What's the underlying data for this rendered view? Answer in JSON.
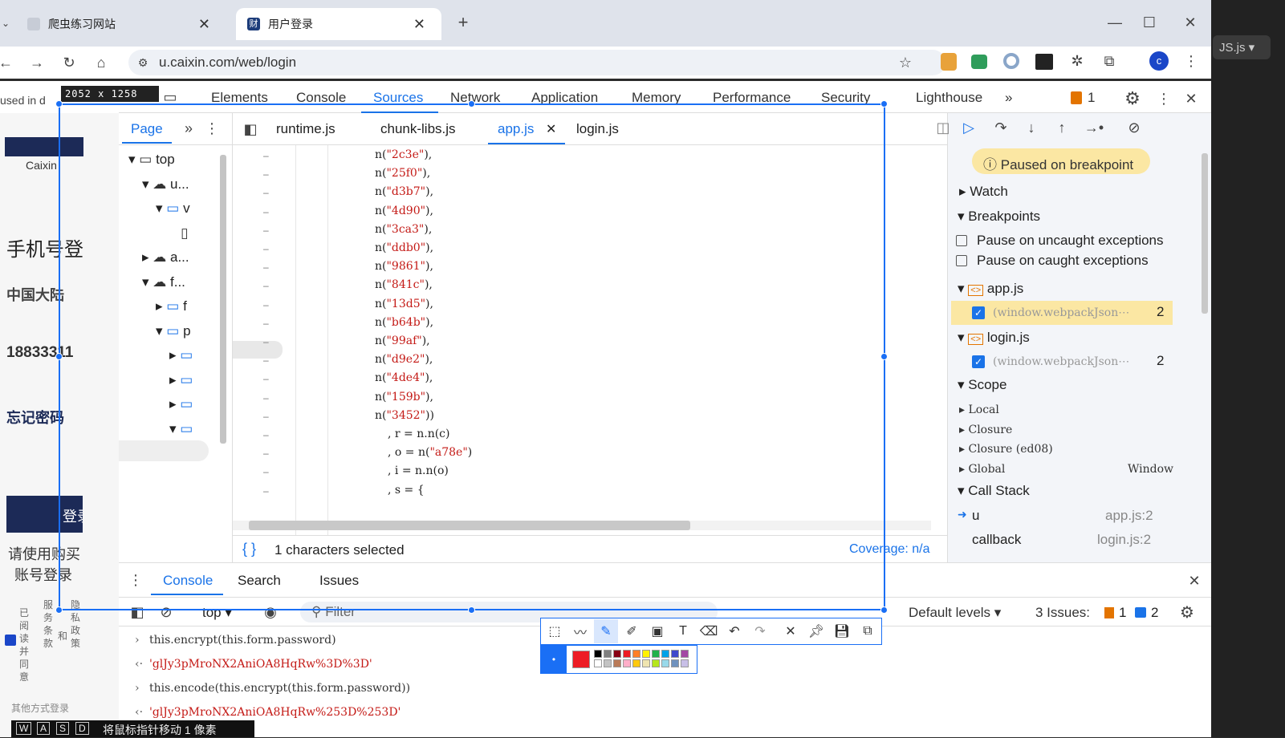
{
  "browser": {
    "tabs": [
      {
        "label": "爬虫练习网站",
        "active": false
      },
      {
        "label": "用户登录",
        "active": true
      }
    ],
    "new_tab": "+",
    "url": "u.caixin.com/web/login",
    "profile_initial": "c"
  },
  "right_edge": {
    "file_chip": "JS.js"
  },
  "size_badge": "2052 x 1258 px",
  "devtools": {
    "left_trunc": "used in d",
    "tabs": [
      "Elements",
      "Console",
      "Sources",
      "Network",
      "Application",
      "Memory",
      "Performance",
      "Security",
      "Lighthouse"
    ],
    "active_tab": "Sources",
    "more": "»",
    "issues_badge": "1",
    "navigator": {
      "tab": "Page",
      "tree": [
        {
          "label": "top",
          "depth": 0,
          "expanded": true,
          "kind": "frame"
        },
        {
          "label": "u...",
          "depth": 1,
          "expanded": true,
          "kind": "cloud"
        },
        {
          "label": "v",
          "depth": 2,
          "expanded": true,
          "kind": "folder"
        },
        {
          "label": "",
          "depth": 3,
          "expanded": null,
          "kind": "file"
        },
        {
          "label": "a...",
          "depth": 1,
          "expanded": false,
          "kind": "cloud"
        },
        {
          "label": "f...",
          "depth": 1,
          "expanded": true,
          "kind": "cloud"
        },
        {
          "label": "f",
          "depth": 2,
          "expanded": false,
          "kind": "folder"
        },
        {
          "label": "p",
          "depth": 2,
          "expanded": true,
          "kind": "folder"
        },
        {
          "label": "",
          "depth": 3,
          "expanded": false,
          "kind": "folder"
        },
        {
          "label": "",
          "depth": 3,
          "expanded": false,
          "kind": "folder"
        },
        {
          "label": "",
          "depth": 3,
          "expanded": false,
          "kind": "folder"
        },
        {
          "label": "",
          "depth": 3,
          "expanded": true,
          "kind": "folder"
        }
      ]
    },
    "file_tabs": [
      "runtime.js",
      "chunk-libs.js",
      "app.js",
      "login.js"
    ],
    "active_file": "app.js",
    "code_lines": [
      "n(\"2c3e\"),",
      "n(\"25f0\"),",
      "n(\"d3b7\"),",
      "n(\"4d90\"),",
      "n(\"3ca3\"),",
      "n(\"ddb0\"),",
      "n(\"9861\"),",
      "n(\"841c\"),",
      "n(\"13d5\"),",
      "n(\"b64b\"),",
      "n(\"99af\"),",
      "n(\"d9e2\"),",
      "n(\"4de4\"),",
      "n(\"159b\"),",
      "n(\"3452\"))",
      ", r = n.n(c)",
      ", o = n(\"a78e\")",
      ", i = n.n(o)",
      ", s = {"
    ],
    "status": "1 characters selected",
    "coverage": "Coverage: n/a",
    "debugger": {
      "paused": "Paused on breakpoint",
      "watch": "Watch",
      "breakpoints": "Breakpoints",
      "pause_uncaught": "Pause on uncaught exceptions",
      "pause_caught": "Pause on caught exceptions",
      "bp_files": [
        {
          "file": "app.js",
          "code": "(window.webpackJson⋯",
          "line": "2"
        },
        {
          "file": "login.js",
          "code": "(window.webpackJson⋯",
          "line": "2"
        }
      ],
      "scope": "Scope",
      "scope_items": [
        {
          "label": "Local",
          "value": ""
        },
        {
          "label": "Closure",
          "value": ""
        },
        {
          "label": "Closure (ed08)",
          "value": ""
        },
        {
          "label": "Global",
          "value": "Window"
        }
      ],
      "call_stack": "Call Stack",
      "frames": [
        {
          "name": "u",
          "loc": "app.js:2"
        },
        {
          "name": "callback",
          "loc": "login.js:2"
        }
      ]
    },
    "drawer": {
      "tabs": [
        "Console",
        "Search",
        "Issues"
      ],
      "active": "Console",
      "context": "top",
      "filter": "Filter",
      "levels": "Default levels",
      "issues_label": "3 Issues:",
      "issues_warn": "1",
      "issues_info": "2",
      "lines": [
        {
          "kind": "in",
          "text": "this.encrypt(this.form.password)"
        },
        {
          "kind": "out",
          "text": "'glJy3pMroNX2AniOA8HqRw%3D%3D'"
        },
        {
          "kind": "in",
          "text": "this.encode(this.encrypt(this.form.password))"
        },
        {
          "kind": "out",
          "text": "'glJy3pMroNX2AniOA8HqRw%253D%253D'"
        }
      ]
    }
  },
  "page_behind": {
    "logo_sub": "Caixin",
    "phone_title": "手机号登",
    "region": "中国大陆",
    "phone": "18833311",
    "forgot": "忘记密码",
    "login_btn": "登录",
    "hint1": "请使用购买",
    "hint2": "账号登录",
    "agree": [
      "已阅",
      "读并",
      "同意",
      "服",
      "务",
      "条",
      "款",
      "和",
      "隐",
      "私",
      "政",
      "策"
    ],
    "other": "其他方式登录"
  },
  "hud": {
    "keys": [
      "W",
      "A",
      "S",
      "D"
    ],
    "text": "将鼠标指针移动 1 像素"
  },
  "palette": [
    "#000000",
    "#7f7f7f",
    "#880015",
    "#ed1c24",
    "#ff7f27",
    "#fff200",
    "#22b14c",
    "#00a2e8",
    "#3f48cc",
    "#a349a4",
    "#ffffff",
    "#c3c3c3",
    "#b97a57",
    "#ffaec9",
    "#ffc90e",
    "#efe4b0",
    "#b5e61d",
    "#99d9ea",
    "#7092be",
    "#c8bfe7"
  ],
  "colors": {
    "accent": "#1a73e8",
    "selection": "#1a6ff5",
    "string": "#c41a16",
    "pen": "#ed1c24"
  }
}
